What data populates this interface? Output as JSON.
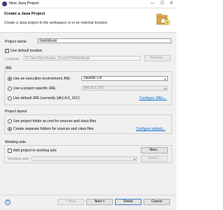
{
  "window": {
    "title": "New Java Project",
    "controls": {
      "minimize": "—",
      "maximize": "☐",
      "close": "✕"
    }
  },
  "banner": {
    "title": "Create a Java Project",
    "description": "Create a Java project in the workspace or in an external location."
  },
  "project": {
    "name_label": "Project name:",
    "name_value": "HelloWorld",
    "use_default_label": "Use default location",
    "use_default_checked": true,
    "location_label": "Location:",
    "location_value": "D:\\Java\\Syncfusion_Docs\\CH\\HelloWorld",
    "browse_label": "Browse..."
  },
  "jre": {
    "title": "JRE",
    "option1": "Use an execution environment JRE:",
    "option1_value": "JavaSE-1.8",
    "option2": "Use a project specific JRE:",
    "option2_value": "jdk1.8.0_161",
    "option3": "Use default JRE (currently 'jdk1.8.0_161')",
    "configure_link": "Configure JREs..."
  },
  "layout": {
    "title": "Project layout",
    "option1": "Use project folder as root for sources and class files",
    "option2": "Create separate folders for sources and class files",
    "configure_link": "Configure default..."
  },
  "working_sets": {
    "title": "Working sets",
    "add_label": "Add project to working sets",
    "new_label": "New...",
    "sets_label": "Working sets:",
    "select_label": "Select..."
  },
  "footer": {
    "help": "?",
    "back": "< Back",
    "next": "Next >",
    "finish": "Finish",
    "cancel": "Cancel"
  }
}
